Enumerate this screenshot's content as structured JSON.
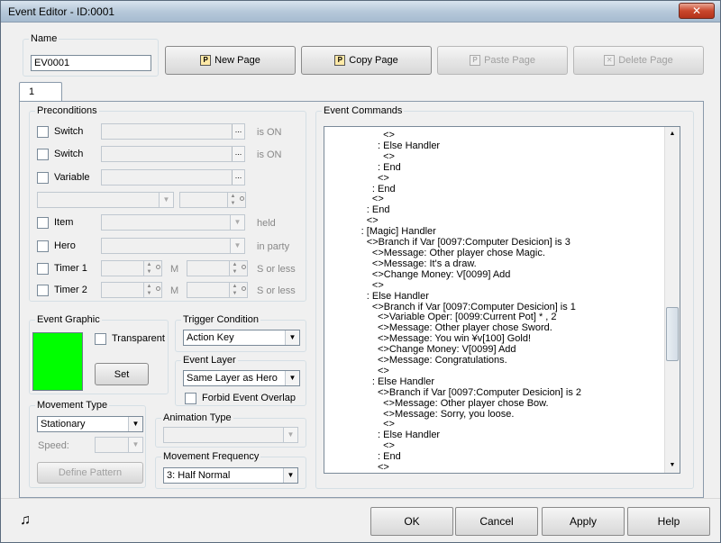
{
  "window": {
    "title": "Event Editor - ID:0001",
    "close_glyph": "✕"
  },
  "name_group": {
    "legend": "Name",
    "value": "EV0001"
  },
  "toolbar": {
    "new_page": "New Page",
    "copy_page": "Copy Page",
    "paste_page": "Paste Page",
    "delete_page": "Delete Page"
  },
  "tabs": [
    {
      "label": "1"
    }
  ],
  "preconditions": {
    "legend": "Preconditions",
    "switch1": "Switch",
    "switch1_suffix": "is ON",
    "switch2": "Switch",
    "switch2_suffix": "is ON",
    "variable": "Variable",
    "item": "Item",
    "item_suffix": "held",
    "hero": "Hero",
    "hero_suffix": "in party",
    "timer1": "Timer 1",
    "timer1_m": "M",
    "timer1_suffix": "S or less",
    "timer2": "Timer 2",
    "timer2_m": "M",
    "timer2_suffix": "S or less",
    "dots": "..."
  },
  "event_graphic": {
    "legend": "Event Graphic",
    "transparent": "Transparent",
    "set": "Set",
    "color": "#00ff00"
  },
  "trigger": {
    "legend": "Trigger Condition",
    "value": "Action Key"
  },
  "layer": {
    "legend": "Event Layer",
    "value": "Same Layer as Hero",
    "forbid": "Forbid Event Overlap"
  },
  "movement_type": {
    "legend": "Movement Type",
    "value": "Stationary",
    "speed_label": "Speed:",
    "define_pattern": "Define Pattern"
  },
  "animation_type": {
    "legend": "Animation Type",
    "value": ""
  },
  "movement_frequency": {
    "legend": "Movement Frequency",
    "value": "3: Half Normal"
  },
  "event_commands": {
    "legend": "Event Commands",
    "lines": [
      "                    <>",
      "                  : Else Handler",
      "                    <>",
      "                  : End",
      "                  <>",
      "                : End",
      "                <>",
      "              : End",
      "              <>",
      "            : [Magic] Handler",
      "              <>Branch if Var [0097:Computer Desicion] is 3",
      "                <>Message: Other player chose Magic.",
      "                <>Message: It's a draw.",
      "                <>Change Money: V[0099] Add",
      "                <>",
      "              : Else Handler",
      "                <>Branch if Var [0097:Computer Desicion] is 1",
      "                  <>Variable Oper: [0099:Current Pot] * , 2",
      "                  <>Message: Other player chose Sword.",
      "                  <>Message: You win ¥v[100] Gold!",
      "                  <>Change Money: V[0099] Add",
      "                  <>Message: Congratulations.",
      "                  <>",
      "                : Else Handler",
      "                  <>Branch if Var [0097:Computer Desicion] is 2",
      "                    <>Message: Other player chose Bow.",
      "                    <>Message: Sorry, you loose.",
      "                    <>",
      "                  : Else Handler",
      "                    <>",
      "                  : End",
      "                  <>",
      "                : End"
    ]
  },
  "footer": {
    "ok": "OK",
    "cancel": "Cancel",
    "apply": "Apply",
    "help": "Help",
    "music_icon": "♫"
  }
}
